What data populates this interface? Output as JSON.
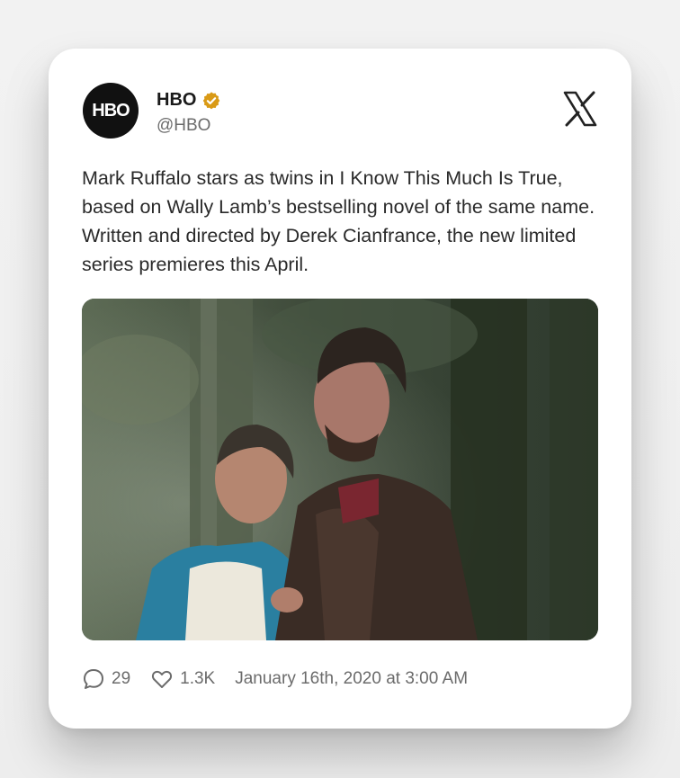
{
  "account": {
    "name": "HBO",
    "handle": "@HBO",
    "avatar_text": "HBO",
    "verified": true,
    "verified_color": "#d99a16"
  },
  "tweet": {
    "text": "Mark Ruffalo stars as twins in I Know This Much Is True, based on Wally Lamb’s bestselling novel of the same name. Written and directed by Derek Cianfrance, the new limited series premieres this April."
  },
  "stats": {
    "replies": "29",
    "likes": "1.3K",
    "timestamp": "January 16th, 2020 at 3:00 AM"
  },
  "icons": {
    "platform": "x-logo-icon",
    "reply": "speech-bubble-icon",
    "like": "heart-icon",
    "verified": "verified-badge-icon"
  }
}
